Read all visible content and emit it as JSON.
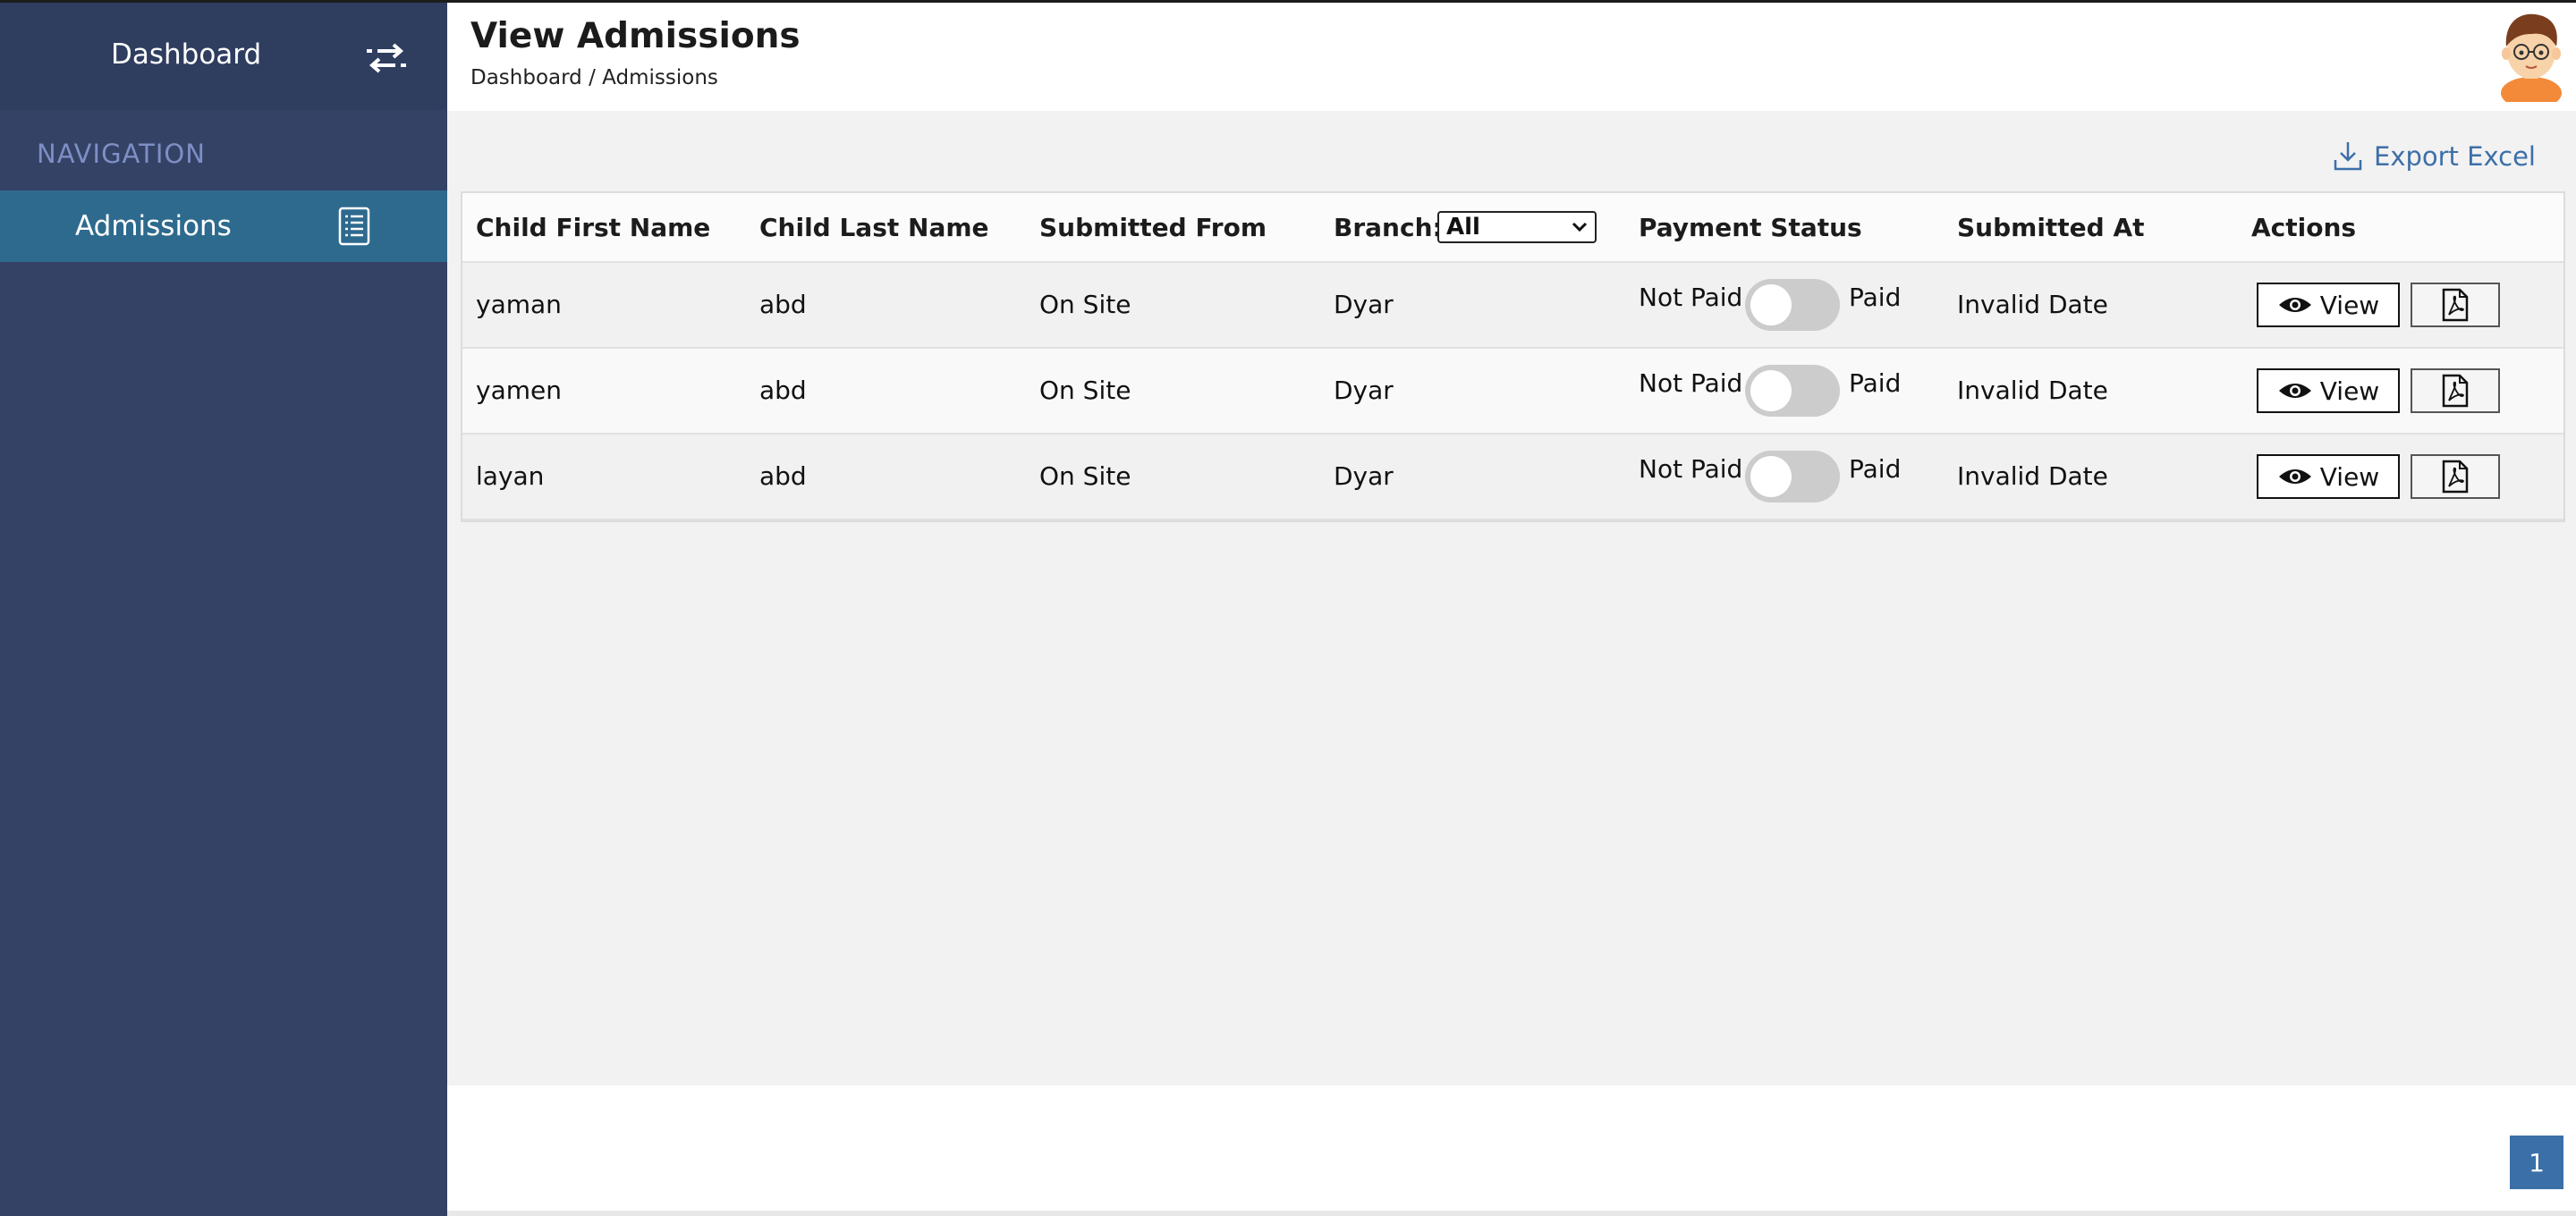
{
  "sidebar": {
    "title": "Dashboard",
    "toggle_icon": "swap-arrows-icon",
    "section_label": "NAVIGATION",
    "items": [
      {
        "label": "Admissions",
        "icon": "list-icon",
        "active": true
      }
    ]
  },
  "header": {
    "title": "View Admissions",
    "breadcrumb": {
      "home": "Dashboard",
      "separator": " / ",
      "current": "Admissions"
    },
    "avatar_icon": "user-avatar"
  },
  "toolbar": {
    "export_label": "Export Excel",
    "export_icon": "download-icon"
  },
  "table": {
    "columns": {
      "first_name": "Child First Name",
      "last_name": "Child Last Name",
      "submitted_from": "Submitted From",
      "branch": "Branch:",
      "payment_status": "Payment Status",
      "submitted_at": "Submitted At",
      "actions": "Actions"
    },
    "branch_filter": {
      "selected": "All"
    },
    "rows": [
      {
        "first_name": "yaman",
        "last_name": "abd",
        "submitted_from": "On Site",
        "branch": "Dyar",
        "pay_off_label": "Not Paid",
        "pay_on_label": "Paid",
        "paid": false,
        "submitted_at": "Invalid Date",
        "view_label": "View"
      },
      {
        "first_name": "yamen",
        "last_name": "abd",
        "submitted_from": "On Site",
        "branch": "Dyar",
        "pay_off_label": "Not Paid",
        "pay_on_label": "Paid",
        "paid": false,
        "submitted_at": "Invalid Date",
        "view_label": "View"
      },
      {
        "first_name": "layan",
        "last_name": "abd",
        "submitted_from": "On Site",
        "branch": "Dyar",
        "pay_off_label": "Not Paid",
        "pay_on_label": "Paid",
        "paid": false,
        "submitted_at": "Invalid Date",
        "view_label": "View"
      }
    ]
  },
  "pagination": {
    "current_page": "1"
  },
  "colors": {
    "sidebar_bg": "#344266",
    "sidebar_active": "#2e6a8e",
    "accent": "#3a6fa8",
    "nav_label": "#7d8fc4"
  }
}
